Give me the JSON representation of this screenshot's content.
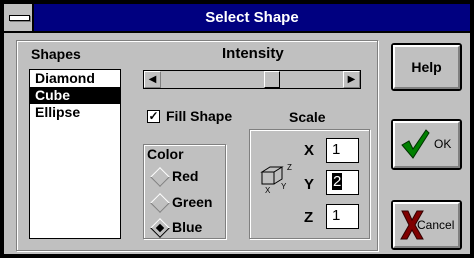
{
  "window": {
    "title": "Select Shape"
  },
  "shapes": {
    "label": "Shapes",
    "items": [
      {
        "label": "Diamond",
        "selected": false
      },
      {
        "label": "Cube",
        "selected": true
      },
      {
        "label": "Ellipse",
        "selected": false
      }
    ]
  },
  "intensity": {
    "label": "Intensity",
    "value_fraction": 0.62
  },
  "fill_shape": {
    "label": "Fill Shape",
    "checked": true
  },
  "color": {
    "label": "Color",
    "options": [
      {
        "label": "Red",
        "selected": false
      },
      {
        "label": "Green",
        "selected": false
      },
      {
        "label": "Blue",
        "selected": true
      }
    ]
  },
  "scale": {
    "label": "Scale",
    "x": {
      "label": "X",
      "value": "1"
    },
    "y": {
      "label": "Y",
      "value": "2"
    },
    "z": {
      "label": "Z",
      "value": "1"
    },
    "axis_icon_labels": {
      "x": "X",
      "y": "Y",
      "z": "Z"
    }
  },
  "buttons": {
    "help": "Help",
    "ok": "OK",
    "cancel": "Cancel"
  },
  "colors": {
    "titlebar": "#000080",
    "face": "#c0c0c0",
    "ok_check": "#008000",
    "cancel_x": "#800000"
  }
}
